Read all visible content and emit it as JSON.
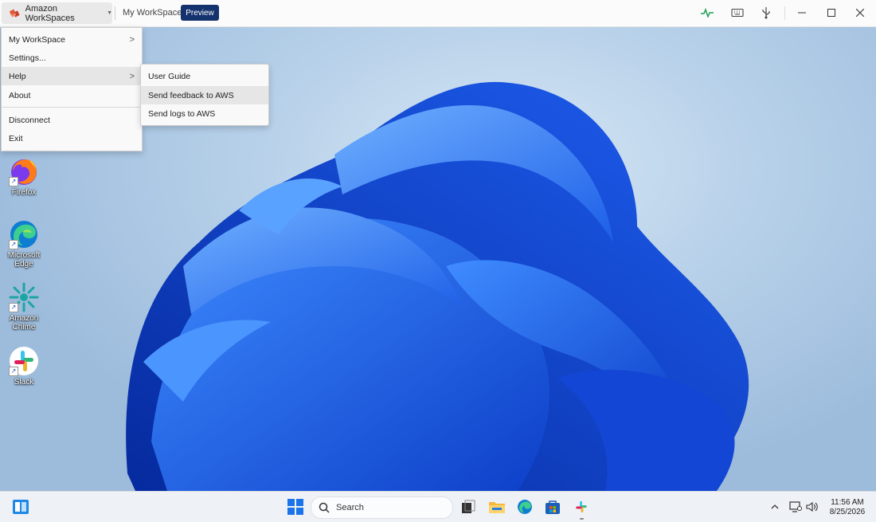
{
  "titlebar": {
    "app_name": "Amazon WorkSpaces",
    "workspace_label": "My WorkSpace",
    "preview_badge": "Preview",
    "icons": [
      "health-monitor-icon",
      "keyboard-icon",
      "usb-icon"
    ],
    "window_controls": [
      "minimize-icon",
      "maximize-icon",
      "close-icon"
    ]
  },
  "main_menu": {
    "items": [
      {
        "label": "My WorkSpace",
        "has_submenu": true
      },
      {
        "label": "Settings...",
        "has_submenu": false
      },
      {
        "label": "Help",
        "has_submenu": true,
        "highlighted": true
      },
      {
        "label": "About",
        "has_submenu": false
      },
      {
        "label": "Disconnect",
        "has_submenu": false
      },
      {
        "label": "Exit",
        "has_submenu": false
      }
    ],
    "chevron": ">"
  },
  "help_submenu": {
    "items": [
      {
        "label": "User Guide"
      },
      {
        "label": "Send feedback to AWS",
        "highlighted": true
      },
      {
        "label": "Send logs to AWS"
      }
    ]
  },
  "desktop_icons": [
    {
      "label": "Firefox",
      "icon": "firefox-icon"
    },
    {
      "label": "Microsoft Edge",
      "icon": "edge-icon"
    },
    {
      "label": "Amazon Chime",
      "icon": "chime-icon"
    },
    {
      "label": "Slack",
      "icon": "slack-icon"
    }
  ],
  "taskbar": {
    "search_placeholder": "Search",
    "pinned": [
      "widgets-icon",
      "start-icon",
      "task-view-icon",
      "file-explorer-icon",
      "edge-icon",
      "store-icon",
      "slack-icon"
    ],
    "tray": [
      "chevron-up-icon",
      "network-icon",
      "volume-icon"
    ],
    "time": "11:56 AM",
    "date": "8/25/2026"
  },
  "colors": {
    "accent": "#14326d",
    "menu_highlight": "#e6e6e6",
    "bloom_blue": "#1a5cf0"
  }
}
